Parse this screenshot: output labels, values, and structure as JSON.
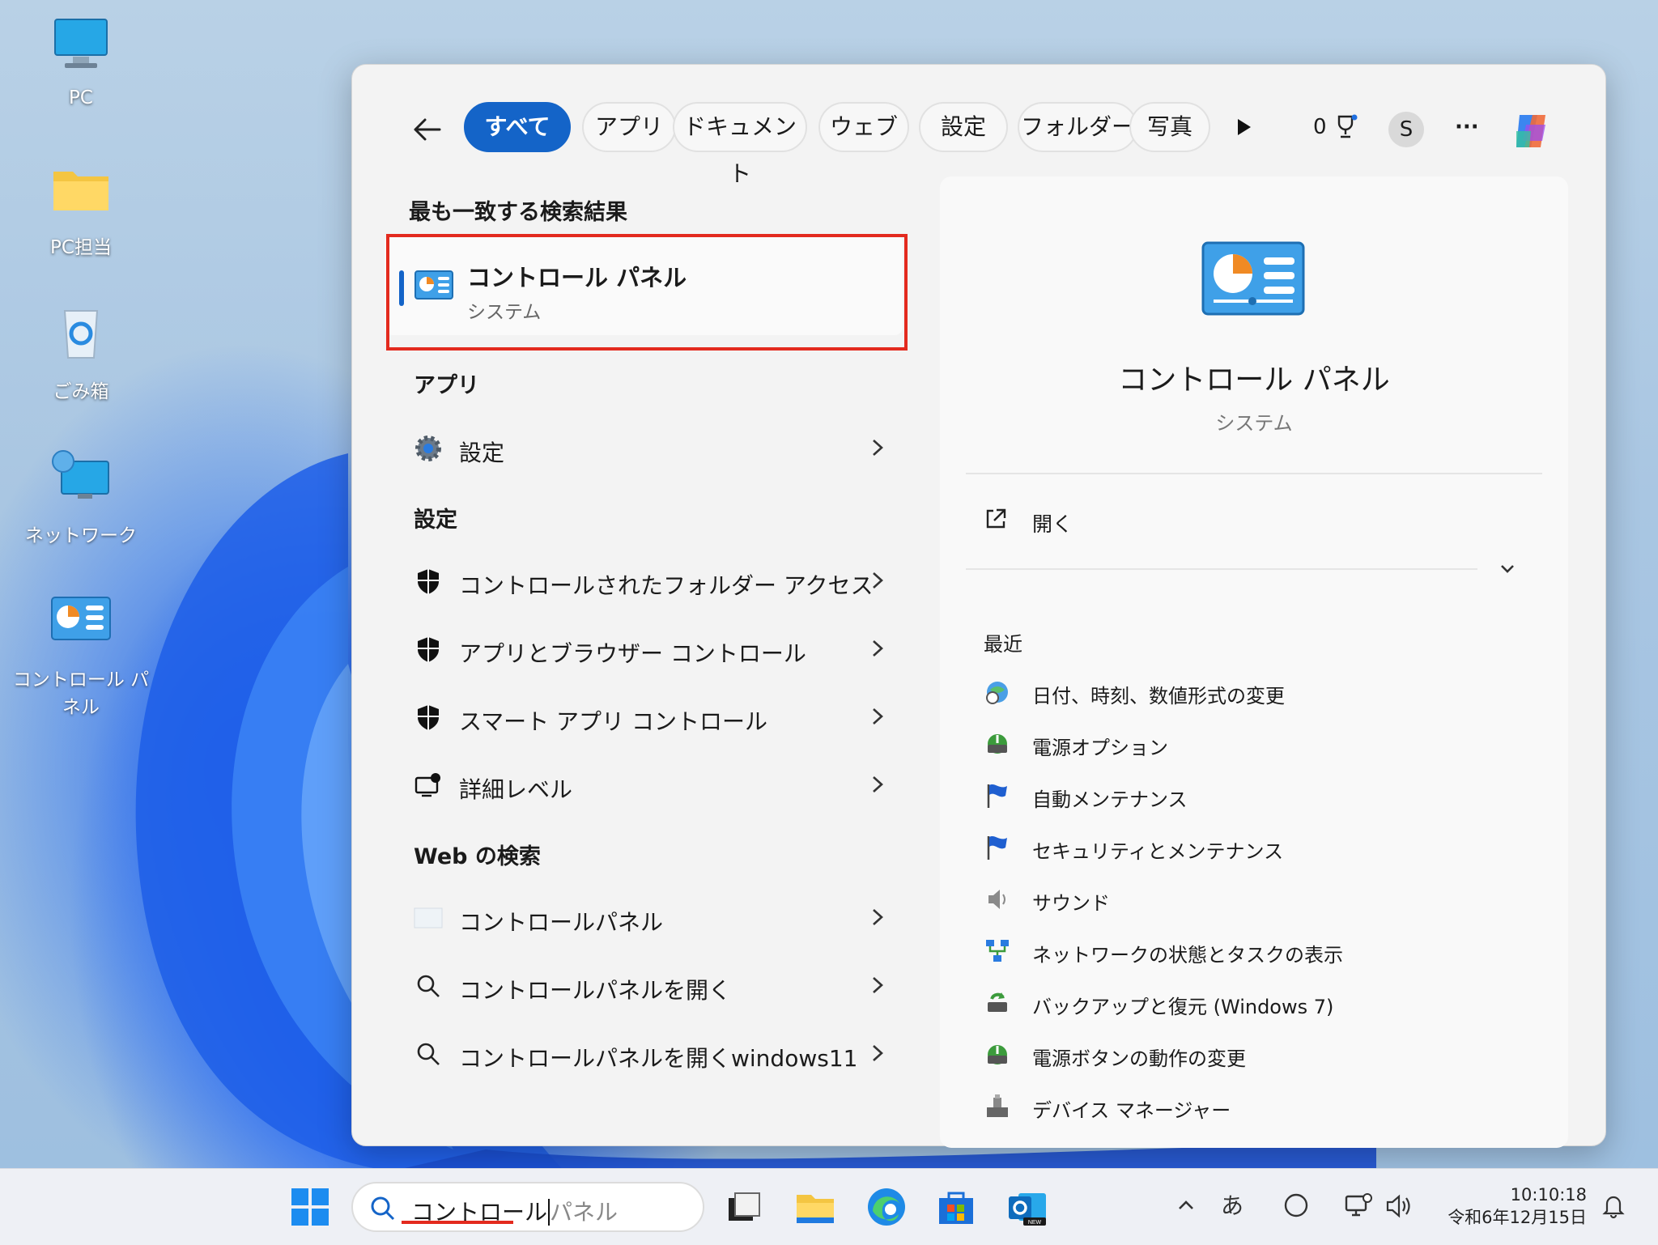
{
  "desktop": {
    "icons": [
      {
        "label": "PC"
      },
      {
        "label": "PC担当"
      },
      {
        "label": "ごみ箱"
      },
      {
        "label": "ネットワーク"
      },
      {
        "label": "コントロール パネル"
      }
    ]
  },
  "search_panel": {
    "filters": [
      "すべて",
      "アプリ",
      "ドキュメント",
      "ウェブ",
      "設定",
      "フォルダー",
      "写真"
    ],
    "active_filter": "すべて",
    "rewards_count": "0",
    "avatar_letter": "S",
    "more_label": "···",
    "best_match": {
      "heading": "最も一致する検索結果",
      "title": "コントロール パネル",
      "subtitle": "システム"
    },
    "apps": {
      "heading": "アプリ",
      "items": [
        {
          "label": "設定"
        }
      ]
    },
    "settings": {
      "heading": "設定",
      "items": [
        {
          "label": "コントロールされたフォルダー アクセス"
        },
        {
          "label": "アプリとブラウザー コントロール"
        },
        {
          "label": "スマート アプリ コントロール"
        },
        {
          "label": "詳細レベル"
        }
      ]
    },
    "web": {
      "heading": "Web の検索",
      "items": [
        {
          "label": "コントロールパネル"
        },
        {
          "label": "コントロールパネルを開く"
        },
        {
          "label": "コントロールパネルを開くwindows11"
        }
      ]
    },
    "detail": {
      "title": "コントロール パネル",
      "subtitle": "システム",
      "open_label": "開く",
      "recent_heading": "最近",
      "recent": [
        {
          "label": "日付、時刻、数値形式の変更",
          "icon": "globe-clock-icon"
        },
        {
          "label": "電源オプション",
          "icon": "power-options-icon"
        },
        {
          "label": "自動メンテナンス",
          "icon": "flag-icon"
        },
        {
          "label": "セキュリティとメンテナンス",
          "icon": "flag-icon"
        },
        {
          "label": "サウンド",
          "icon": "speaker-icon"
        },
        {
          "label": "ネットワークの状態とタスクの表示",
          "icon": "network-icon"
        },
        {
          "label": "バックアップと復元 (Windows 7)",
          "icon": "backup-icon"
        },
        {
          "label": "電源ボタンの動作の変更",
          "icon": "power-options-icon"
        },
        {
          "label": "デバイス マネージャー",
          "icon": "device-manager-icon"
        }
      ]
    }
  },
  "taskbar": {
    "search_typed": "コントロール",
    "search_suggest": "パネル",
    "ime_label": "あ",
    "time": "10:10:18",
    "date": "令和6年12月15日"
  },
  "colors": {
    "accent": "#1464c8",
    "highlight": "#e32a1e"
  }
}
